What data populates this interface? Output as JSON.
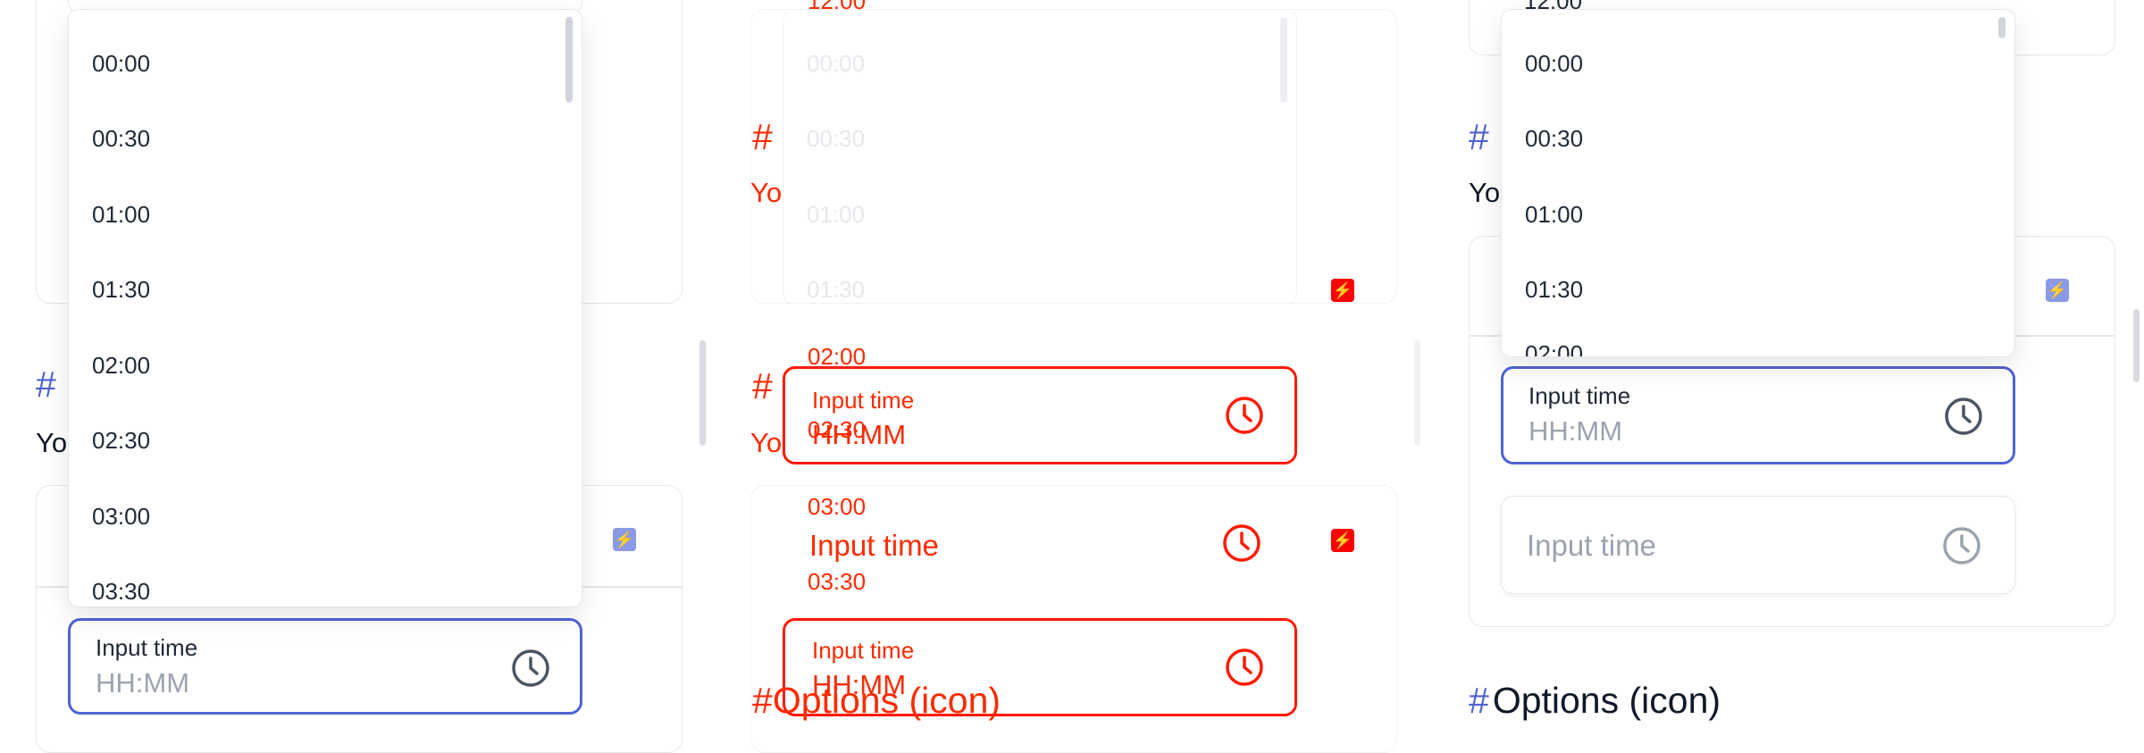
{
  "section_title": "Options (icon)",
  "section_title_partial": "Options (icon)",
  "hash": "#",
  "para_partial": "Yo",
  "time_value_partial": "12:00",
  "input": {
    "label": "Input time",
    "placeholder": "HH:MM"
  },
  "times": [
    "00:00",
    "00:30",
    "01:00",
    "01:30",
    "02:00",
    "02:30",
    "03:00",
    "03:30"
  ],
  "right_times": [
    "00:00",
    "00:30",
    "01:00",
    "01:30",
    "02:00"
  ],
  "bolt_glyph": "⚡",
  "colors": {
    "accent": "#4f63d2",
    "overlay_red": "#ff1a00",
    "bolt_badge": "#8b9ae6"
  },
  "icons": {
    "clock": "clock-icon",
    "bolt": "bolt-icon"
  }
}
